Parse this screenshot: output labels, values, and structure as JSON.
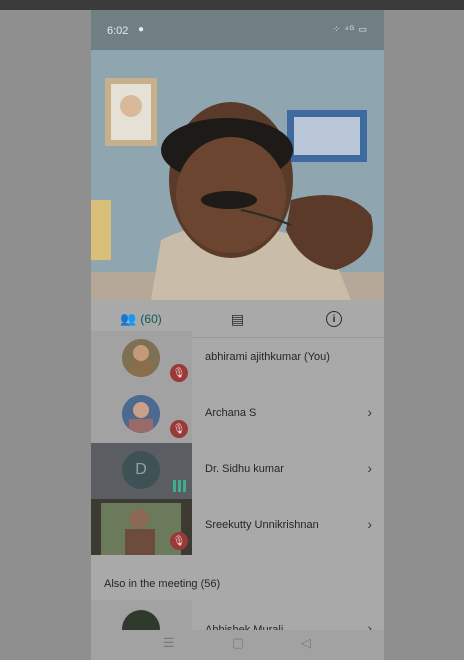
{
  "status_bar": {
    "time": "6:02",
    "indicators": "⚲ ⁴ᴳ ▭"
  },
  "tabs": {
    "participants_count": "(60)"
  },
  "participants": [
    {
      "name": "abhirami ajithkumar (You)",
      "muted": true,
      "has_chevron": false
    },
    {
      "name": "Archana S",
      "muted": true,
      "has_chevron": true
    },
    {
      "name": "Dr. Sidhu kumar",
      "avatar_letter": "D",
      "speaking": true,
      "has_chevron": true
    },
    {
      "name": "Sreekutty Unnikrishnan",
      "muted": true,
      "has_chevron": true
    }
  ],
  "section": {
    "also_in_meeting": "Also in the meeting (56)"
  },
  "partial_participant": {
    "name": "Abhishek Murali"
  },
  "colors": {
    "accent": "#12594f",
    "mute_red": "#9a3a38",
    "speaking_green": "#3fae8a"
  }
}
